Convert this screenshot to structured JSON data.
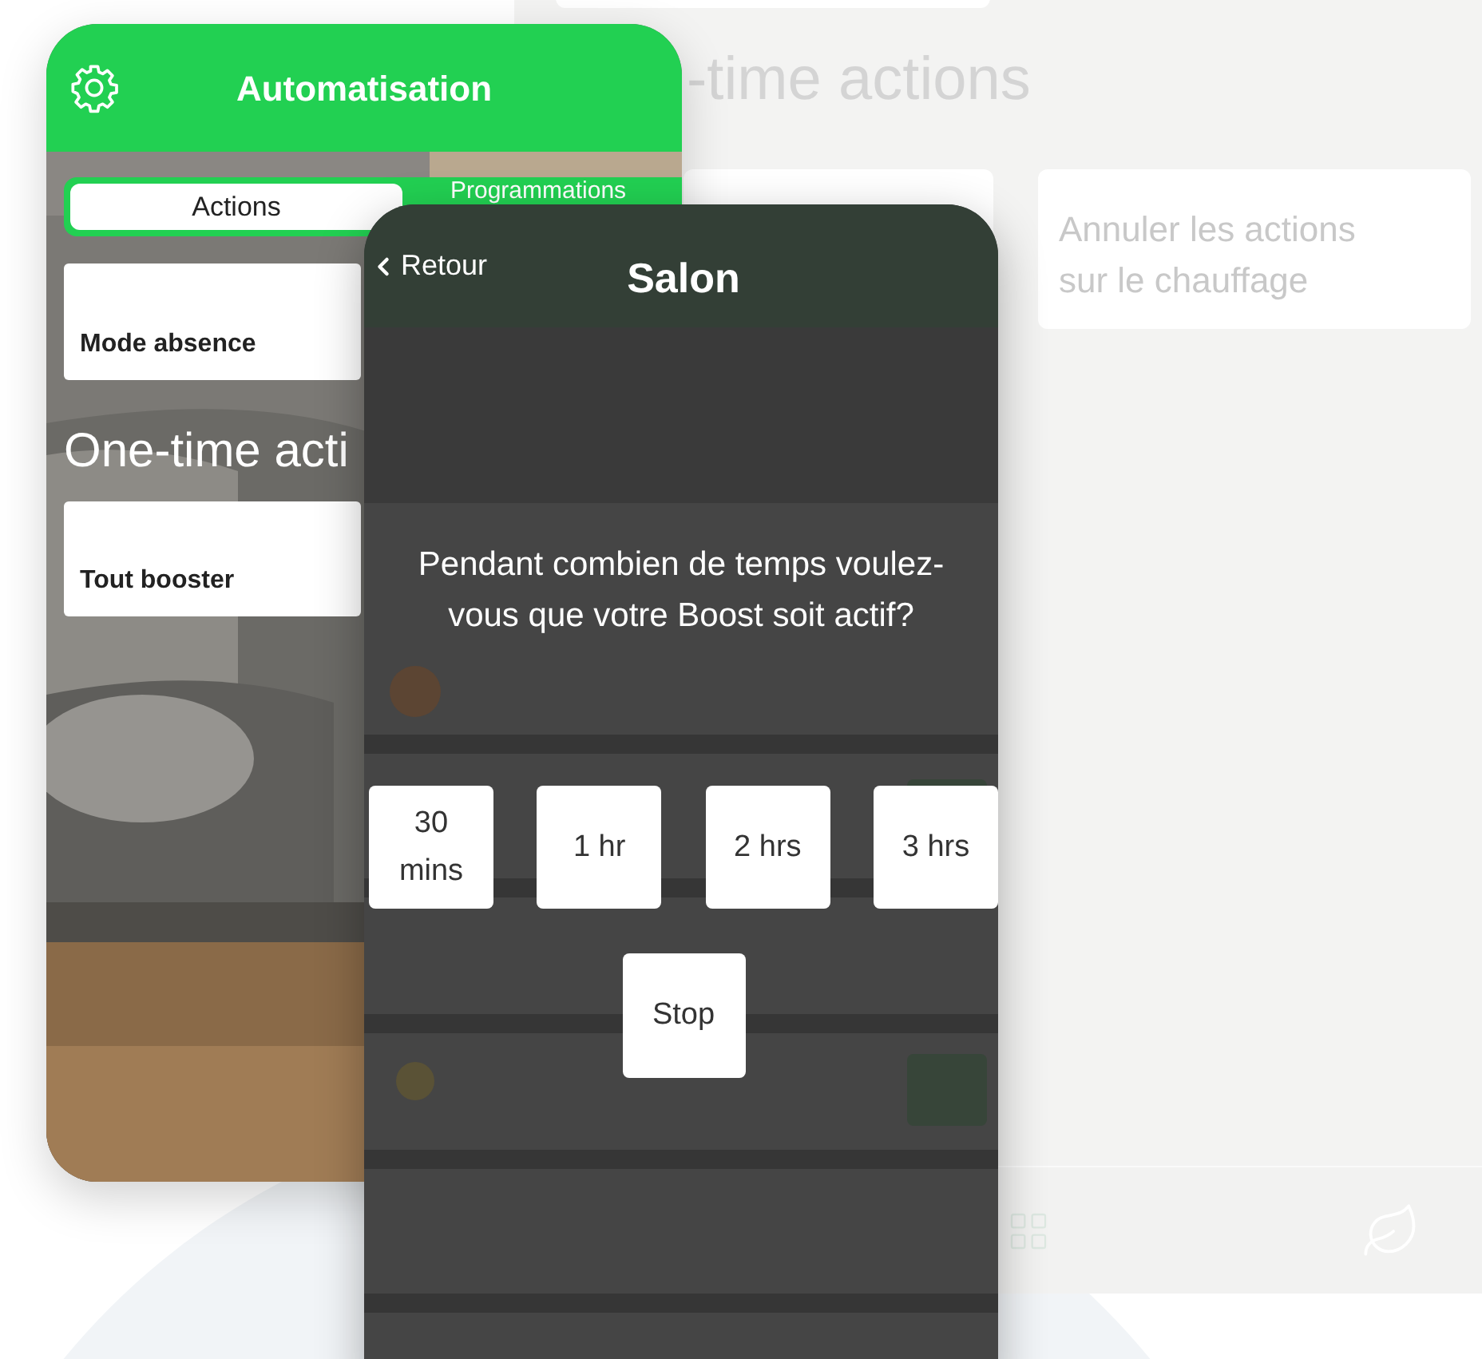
{
  "background_screen": {
    "heading": "-time actions",
    "cards": [
      "Annuler les actions sur le chauffage"
    ]
  },
  "automation_screen": {
    "title": "Automatisation",
    "tabs": [
      {
        "label": "Actions",
        "selected": true
      },
      {
        "label": "Programmations",
        "selected": false
      }
    ],
    "actions": [
      "Mode absence"
    ],
    "section_title": "One-time acti",
    "one_time_actions": [
      "Tout booster"
    ]
  },
  "boost_screen": {
    "back": "Retour",
    "title": "Salon",
    "question": "Pendant combien de temps voulez-vous que votre Boost soit actif?",
    "durations": [
      "30 mins",
      "1 hr",
      "2 hrs",
      "3 hrs"
    ],
    "stop": "Stop"
  }
}
